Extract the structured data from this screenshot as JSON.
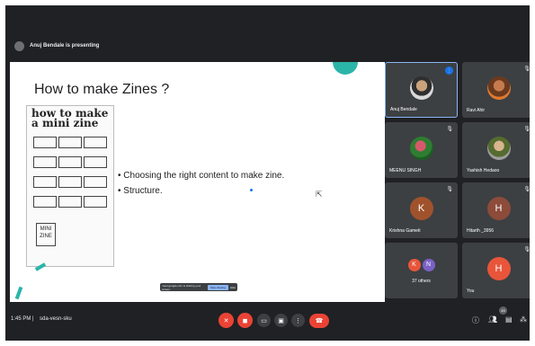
{
  "topbar": {
    "presenting_text": "Anuj Bendale is presenting"
  },
  "slide": {
    "title": "How to make Zines ?",
    "zine_heading": "how to make a mini zine",
    "mini_zine_label": "MINI ZINE",
    "bullets": [
      "• Choosing the right content to make zine.",
      "• Structure."
    ]
  },
  "share_bar": {
    "text": "meet.google.com is sharing your screen.",
    "stop_label": "Stop sharing",
    "hide_label": "Hide"
  },
  "participants": [
    {
      "name": "Anuj Bendale",
      "avatar": "photo",
      "speaking": true
    },
    {
      "name": "Ravi Ahir",
      "avatar": "photo"
    },
    {
      "name": "MEENU SINGH",
      "avatar": "photo"
    },
    {
      "name": "Yashish Hedaoo",
      "avatar": "photo"
    },
    {
      "name": "Krishna Gameti",
      "initial": "K"
    },
    {
      "name": "Hitarth _3956",
      "initial": "H"
    },
    {
      "name": "37 others",
      "initials": [
        "K",
        "N"
      ]
    },
    {
      "name": "You",
      "initial": "H"
    }
  ],
  "bottombar": {
    "time": "1:45 PM",
    "separator": "|",
    "meeting_code": "sda-vesn-sku",
    "people_badge": "45"
  },
  "icons": {
    "mic_off": "mic-off-icon",
    "cam_off": "camera-off-icon",
    "captions": "captions-icon",
    "present": "present-icon",
    "more": "more-icon",
    "end_call": "end-call-icon",
    "info": "info-icon",
    "people": "people-icon",
    "chat": "chat-icon",
    "activities": "activities-icon"
  },
  "colors": {
    "accent": "#8ab4f8",
    "danger": "#ea4335",
    "teal": "#2bb5a8",
    "bg": "#202124"
  }
}
